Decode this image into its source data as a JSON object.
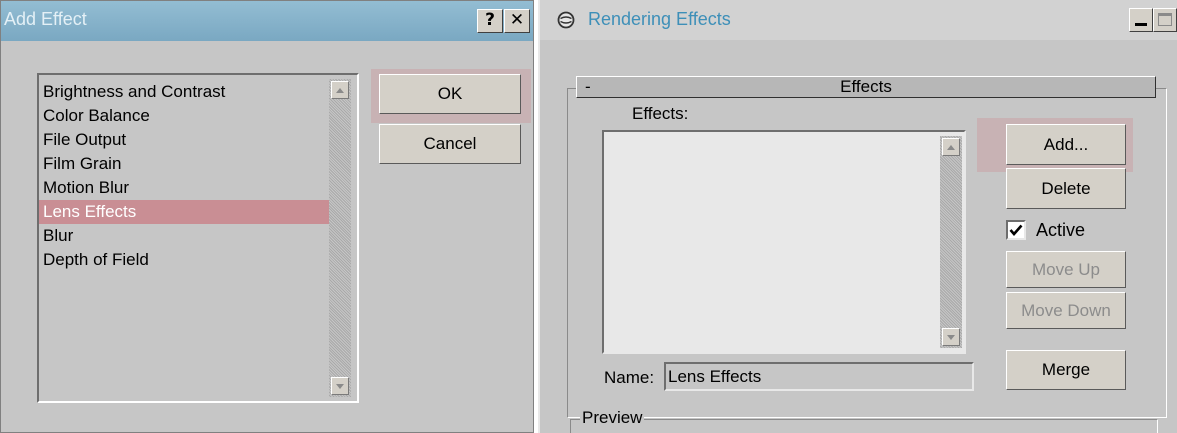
{
  "add_effect_dialog": {
    "title": "Add Effect",
    "help_button": "?",
    "close_button": "✕",
    "effects_list": [
      "Brightness and Contrast",
      "Color Balance",
      "File Output",
      "Film Grain",
      "Motion Blur",
      "Lens Effects",
      "Blur",
      "Depth of Field"
    ],
    "selected_effect": "Lens Effects",
    "ok_button": "OK",
    "cancel_button": "Cancel"
  },
  "rendering_effects_window": {
    "title": "Rendering Effects",
    "rollout": {
      "collapse_symbol": "-",
      "title": "Effects",
      "effects_label": "Effects:",
      "add_button": "Add...",
      "delete_button": "Delete",
      "active_label": "Active",
      "active_checked": true,
      "move_up_button": "Move Up",
      "move_down_button": "Move Down",
      "merge_button": "Merge",
      "name_label": "Name:",
      "name_value": "Lens Effects"
    },
    "preview_group_label": "Preview"
  },
  "colors": {
    "selection": "#c98e94",
    "highlight": "#d07880",
    "title_accent": "#3d8fb8"
  }
}
